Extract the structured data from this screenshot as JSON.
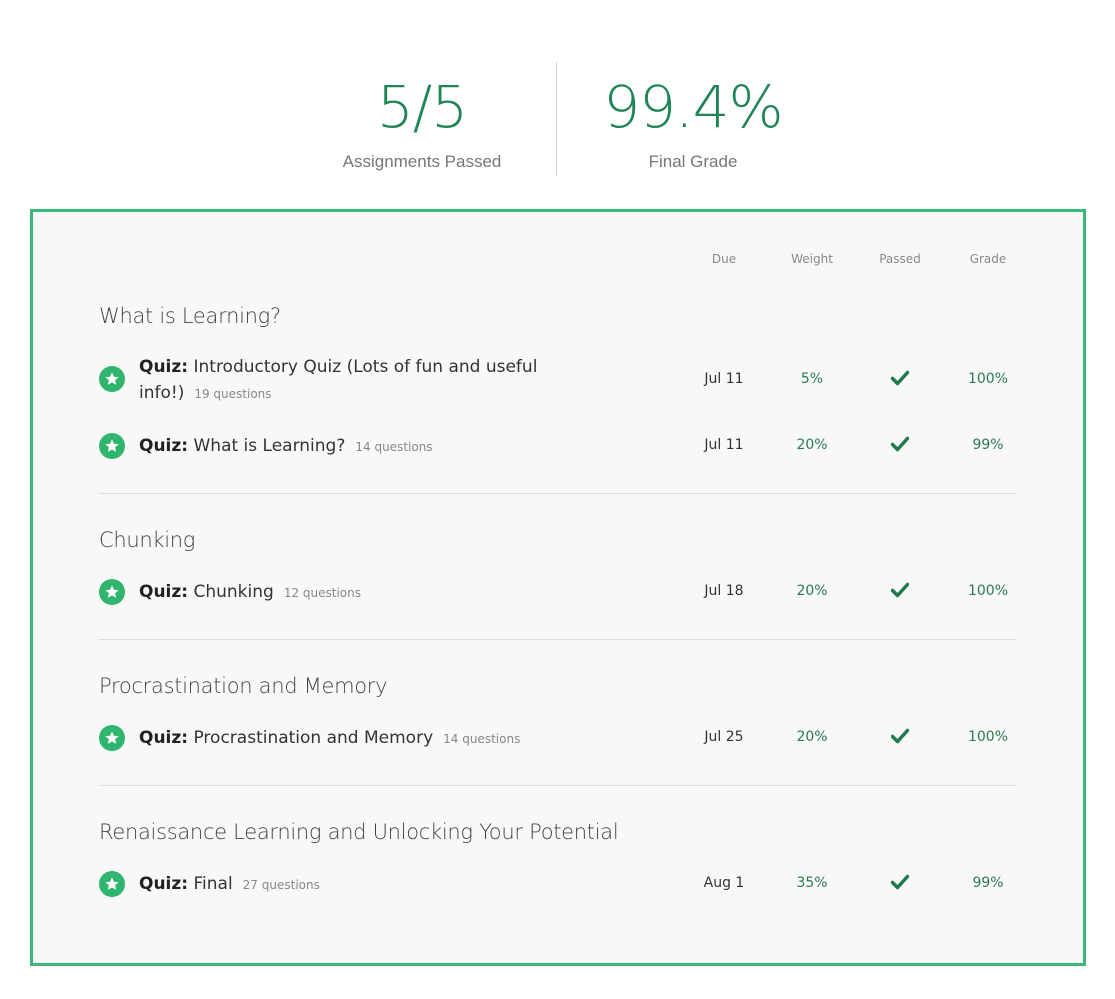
{
  "summary": {
    "assignments_value": "5/5",
    "assignments_label": "Assignments Passed",
    "grade_value": "99.4%",
    "grade_label": "Final Grade"
  },
  "columns": {
    "due": "Due",
    "weight": "Weight",
    "passed": "Passed",
    "grade": "Grade"
  },
  "colors": {
    "accent": "#1f8554",
    "border": "#3cb77a",
    "star": "#2fb56d"
  },
  "sections": [
    {
      "title": "What is Learning?",
      "items": [
        {
          "prefix": "Quiz:",
          "name_line1": "Introductory Quiz (Lots of fun and useful",
          "name_line2": "info!)",
          "questions": "19 questions",
          "due": "Jul 11",
          "weight": "5%",
          "grade": "100%",
          "passed": true
        },
        {
          "prefix": "Quiz:",
          "name": "What is Learning?",
          "questions": "14 questions",
          "due": "Jul 11",
          "weight": "20%",
          "grade": "99%",
          "passed": true
        }
      ]
    },
    {
      "title": "Chunking",
      "items": [
        {
          "prefix": "Quiz:",
          "name": "Chunking",
          "questions": "12 questions",
          "due": "Jul 18",
          "weight": "20%",
          "grade": "100%",
          "passed": true
        }
      ]
    },
    {
      "title": "Procrastination and Memory",
      "items": [
        {
          "prefix": "Quiz:",
          "name": "Procrastination and Memory",
          "questions": "14 questions",
          "due": "Jul 25",
          "weight": "20%",
          "grade": "100%",
          "passed": true
        }
      ]
    },
    {
      "title": "Renaissance Learning and Unlocking Your Potential",
      "items": [
        {
          "prefix": "Quiz:",
          "name": "Final",
          "questions": "27 questions",
          "due": "Aug 1",
          "weight": "35%",
          "grade": "99%",
          "passed": true
        }
      ]
    }
  ]
}
